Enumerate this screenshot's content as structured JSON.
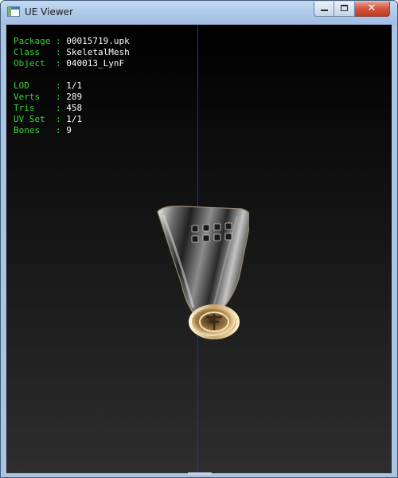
{
  "window": {
    "title": "UE Viewer",
    "controls": {
      "minimize": "—",
      "maximize": "□",
      "close": "✕"
    }
  },
  "info": {
    "package_label": "Package",
    "package_value": "00015719.upk",
    "class_label": "Class",
    "class_value": "SkeletalMesh",
    "object_label": "Object",
    "object_value": "040013_LynF",
    "lod_label": "LOD",
    "lod_value": "1/1",
    "verts_label": "Verts",
    "verts_value": "289",
    "tris_label": "Tris",
    "tris_value": "458",
    "uvset_label": "UV Set",
    "uvset_value": "1/1",
    "bones_label": "Bones",
    "bones_value": "9"
  },
  "colors": {
    "label": "#3ad23a",
    "value": "#ffffff",
    "axis": "#1c2ad2"
  },
  "model": {
    "icon": "metal-tag-charm-mesh"
  }
}
